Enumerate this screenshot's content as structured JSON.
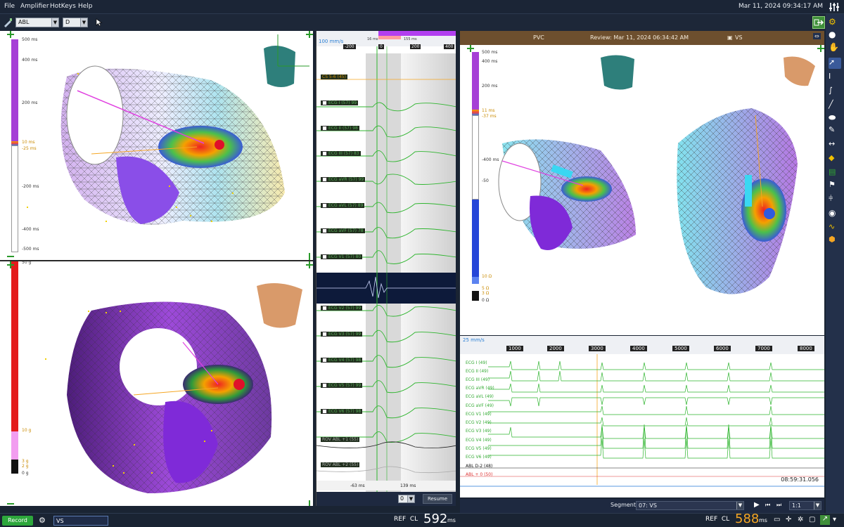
{
  "menu": {
    "file": "File",
    "amplifier": "Amplifier",
    "hotkeys": "HotKeys",
    "help": "Help",
    "clock": "Mar 11, 2024 09:34:17 AM"
  },
  "toolbar": {
    "catheter_value": "ABL",
    "mode_value": "D"
  },
  "left_map_top": {
    "scale_labels": [
      "500 ms",
      "400 ms",
      "200 ms",
      "10 ms",
      "-25 ms",
      "-200 ms",
      "-400 ms",
      "-500 ms"
    ]
  },
  "left_map_bottom": {
    "scale_labels": [
      "50 g",
      "10 g",
      "3 g",
      "2 g",
      "0 g"
    ]
  },
  "ecg": {
    "speed": "100 mm/s",
    "timeline": [
      "-200",
      "0",
      "200",
      "400"
    ],
    "window_left": "16 ms",
    "window_right": "155 ms",
    "cs_label": "CS  5-6  (45)",
    "channels": [
      "ECG I  (57)  99",
      "ECG II  (57)  98",
      "ECG III  (57)  83",
      "ECG aVR  (57)  99",
      "ECG aVL  (57)  89",
      "ECG aVF  (57)  78",
      "ECG V1  (57)  80",
      "ECG V2  (57)  99",
      "ECG V3  (57)  99",
      "ECG V4  (57)  98",
      "ECG V5  (57)  99",
      "ECG V6  (57)  98"
    ],
    "bottom_channels": [
      "ROV ABL  +1  (55)",
      "ROV ABL  +2  (55)"
    ],
    "marker_left": "-63 ms",
    "marker_right": "139 ms",
    "zoom_value": "0",
    "resume": "Resume"
  },
  "review": {
    "title": "PVC",
    "subtitle": "Review: Mar 11, 2024 06:34:42 AM",
    "map_name": "VS",
    "scale_labels": [
      "500 ms",
      "400 ms",
      "200 ms",
      "11 ms",
      "-37 ms",
      "-400 ms",
      "-50"
    ],
    "imp_labels": [
      "10 Ω",
      "5 Ω",
      "3 Ω",
      "0 Ω"
    ]
  },
  "review_wave": {
    "speed": "25 mm/s",
    "timeline": [
      "1000",
      "2000",
      "3000",
      "4000",
      "5000",
      "6000",
      "7000",
      "8000"
    ],
    "channels": [
      "ECG I (49)",
      "ECG II (49)",
      "ECG III (49)",
      "ECG aVR (49)",
      "ECG aVL (49)",
      "ECG aVF (49)",
      "ECG V1 (49)",
      "ECG V2 (49)",
      "ECG V3 (49)",
      "ECG V4 (49)",
      "ECG V5 (49)",
      "ECG V6 (49)"
    ],
    "abl_d2": "ABL   D-2  (48)",
    "abl_plus": "ABL + 0  (50)",
    "time": "08:59:31.056"
  },
  "segment": {
    "label": "Segment",
    "value": "07: VS",
    "ratio": "1:1"
  },
  "status": {
    "record": "Record",
    "input": "VS",
    "ref": "REF",
    "cl": "CL",
    "cl_value_left": "592",
    "unit": "ms",
    "cl_value_right": "588"
  },
  "colors": {
    "accent_orange": "#f5a623",
    "ecg_green": "#2fb52f",
    "menu_bg": "#1b2536",
    "review_header": "#6d4f2e"
  }
}
